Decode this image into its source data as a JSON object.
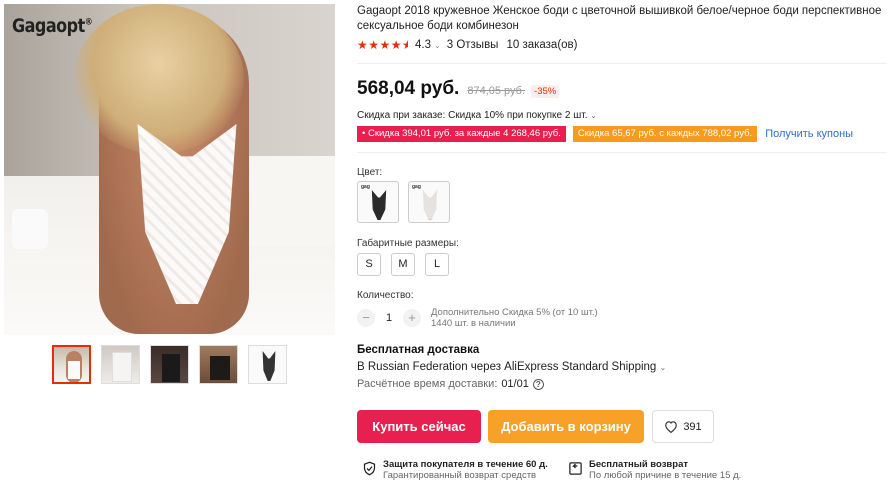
{
  "brand_logo": "Gagaopt",
  "product": {
    "title": "Gagaopt 2018 кружевное Женское боди с цветочной вышивкой белое/черное боди перспективное сексуальное боди комбинезон",
    "rating": {
      "stars_value": 4.3,
      "score": "4.3",
      "reviews": "3 Отзывы",
      "orders": "10 заказа(ов)"
    },
    "price": {
      "current": "568,04 руб.",
      "old": "874,05 руб.",
      "discount": "-35%"
    },
    "order_discount": "Скидка при заказе: Скидка 10% при покупке 2 шт.",
    "coupons": {
      "red": "• Скидка 394,01 руб. за каждые 4 268,46 руб.",
      "orange": "Скидка 65,67 руб. с каждых 788,02 руб.",
      "get_link": "Получить купоны"
    },
    "color_label": "Цвет:",
    "colors": [
      "black",
      "white"
    ],
    "size_label": "Габаритные размеры:",
    "sizes": [
      "S",
      "M",
      "L"
    ],
    "quantity_label": "Количество:",
    "quantity": {
      "minus": "−",
      "value": "1",
      "plus": "+",
      "extra_discount": "Дополнительно Скидка 5% (от 10 шт.)",
      "stock": "1440 шт. в наличии"
    },
    "shipping": {
      "title": "Бесплатная доставка",
      "line": "В Russian Federation через AliExpress Standard Shipping",
      "time_label": "Расчётное время доставки:",
      "time_value": "01/01"
    },
    "buttons": {
      "buy_now": "Купить сейчас",
      "add_to_cart": "Добавить в корзину",
      "wishlist_count": "391"
    },
    "guarantees": {
      "protection_title": "Защита покупателя в течение 60 д.",
      "protection_sub": "Гарантированный возврат средств",
      "return_title": "Бесплатный возврат",
      "return_sub": "По любой причине в течение 15 д."
    }
  },
  "colors": {
    "accent_red": "#e8204f",
    "accent_orange": "#f7a128",
    "link_blue": "#2b70c9",
    "star": "#e62e04"
  }
}
